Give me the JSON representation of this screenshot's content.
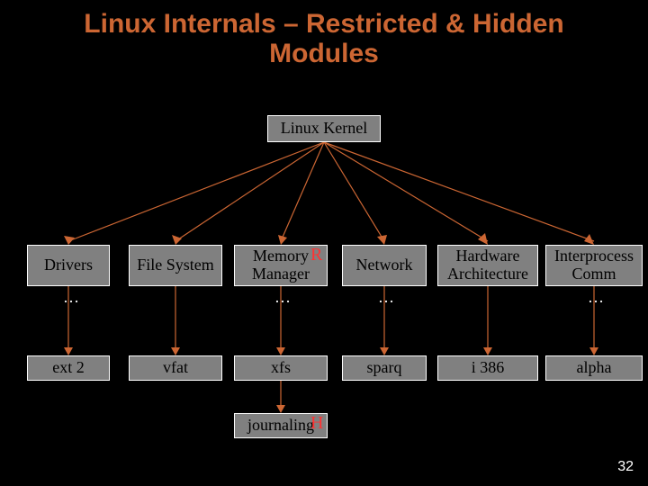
{
  "title_line1": "Linux Internals – Restricted & Hidden",
  "title_line2": "Modules",
  "kernel": "Linux Kernel",
  "row_b": {
    "drivers": "Drivers",
    "fs": "File System",
    "mem1": "Memory",
    "mem2": "Manager",
    "net": "Network",
    "hw1": "Hardware",
    "hw2": "Architecture",
    "ipc1": "Interprocess",
    "ipc2": "Comm"
  },
  "ellipsis": "…",
  "row_c": {
    "c1": "ext 2",
    "c2": "vfat",
    "c3": "xfs",
    "c4": "sparq",
    "c5": "i 386",
    "c6": "alpha"
  },
  "row_d": {
    "d3": "journaling"
  },
  "badges": {
    "r": "R",
    "h": "H"
  },
  "slide_number": "32"
}
